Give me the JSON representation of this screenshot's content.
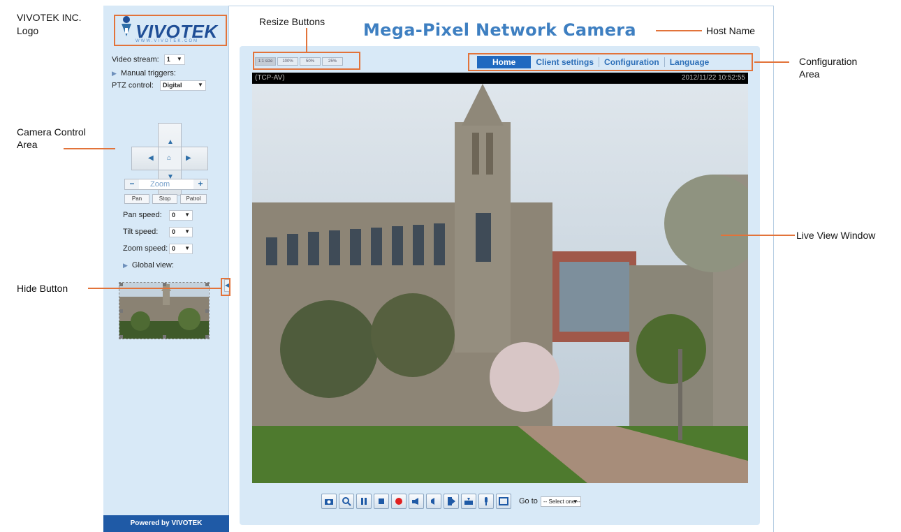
{
  "colors": {
    "annotation": "#e2733a",
    "brand_blue": "#1f4e96",
    "panel_bg": "#d8e9f7",
    "nav_active": "#1f69c0",
    "title_blue": "#3e7fc1"
  },
  "header": {
    "host_name": "Mega-Pixel Network Camera"
  },
  "logo": {
    "text": "VIVOTEK",
    "sub": "WWW.VIVOTEK.COM"
  },
  "sidebar": {
    "video_stream_label": "Video stream:",
    "video_stream_value": "1",
    "manual_triggers_label": "Manual triggers:",
    "ptz_control_label": "PTZ control:",
    "ptz_control_value": "Digital",
    "zoom_label": "Zoom",
    "zoom_out": "−",
    "zoom_in": "+",
    "pan_btn": "Pan",
    "stop_btn": "Stop",
    "patrol_btn": "Patrol",
    "pan_speed_label": "Pan speed:",
    "pan_speed_value": "0",
    "tilt_speed_label": "Tilt speed:",
    "tilt_speed_value": "0",
    "zoom_speed_label": "Zoom speed:",
    "zoom_speed_value": "0",
    "global_view_label": "Global view:",
    "powered_by": "Powered by VIVOTEK"
  },
  "resize_buttons": [
    "1:1 size",
    "100%",
    "50%",
    "25%"
  ],
  "nav": [
    "Home",
    "Client settings",
    "Configuration",
    "Language"
  ],
  "video": {
    "stream_label": "(TCP-AV)",
    "timestamp": "2012/11/22 10:52:55"
  },
  "toolbar": {
    "icons": [
      "snapshot-icon",
      "digital-zoom-icon",
      "pause-icon",
      "stop-icon",
      "record-icon",
      "volume-icon",
      "mute-icon",
      "talk-icon",
      "mic-icon",
      "microphone-icon",
      "fullscreen-icon"
    ],
    "goto_label": "Go to",
    "goto_value": "-- Select one --"
  },
  "annotations": {
    "logo": "VIVOTEK INC.\nLogo",
    "resize": "Resize Buttons",
    "host": "Host Name",
    "config": "Configuration\nArea",
    "camera_control": "Camera Control\nArea",
    "live_view": "Live View Window",
    "hide": "Hide Button"
  }
}
